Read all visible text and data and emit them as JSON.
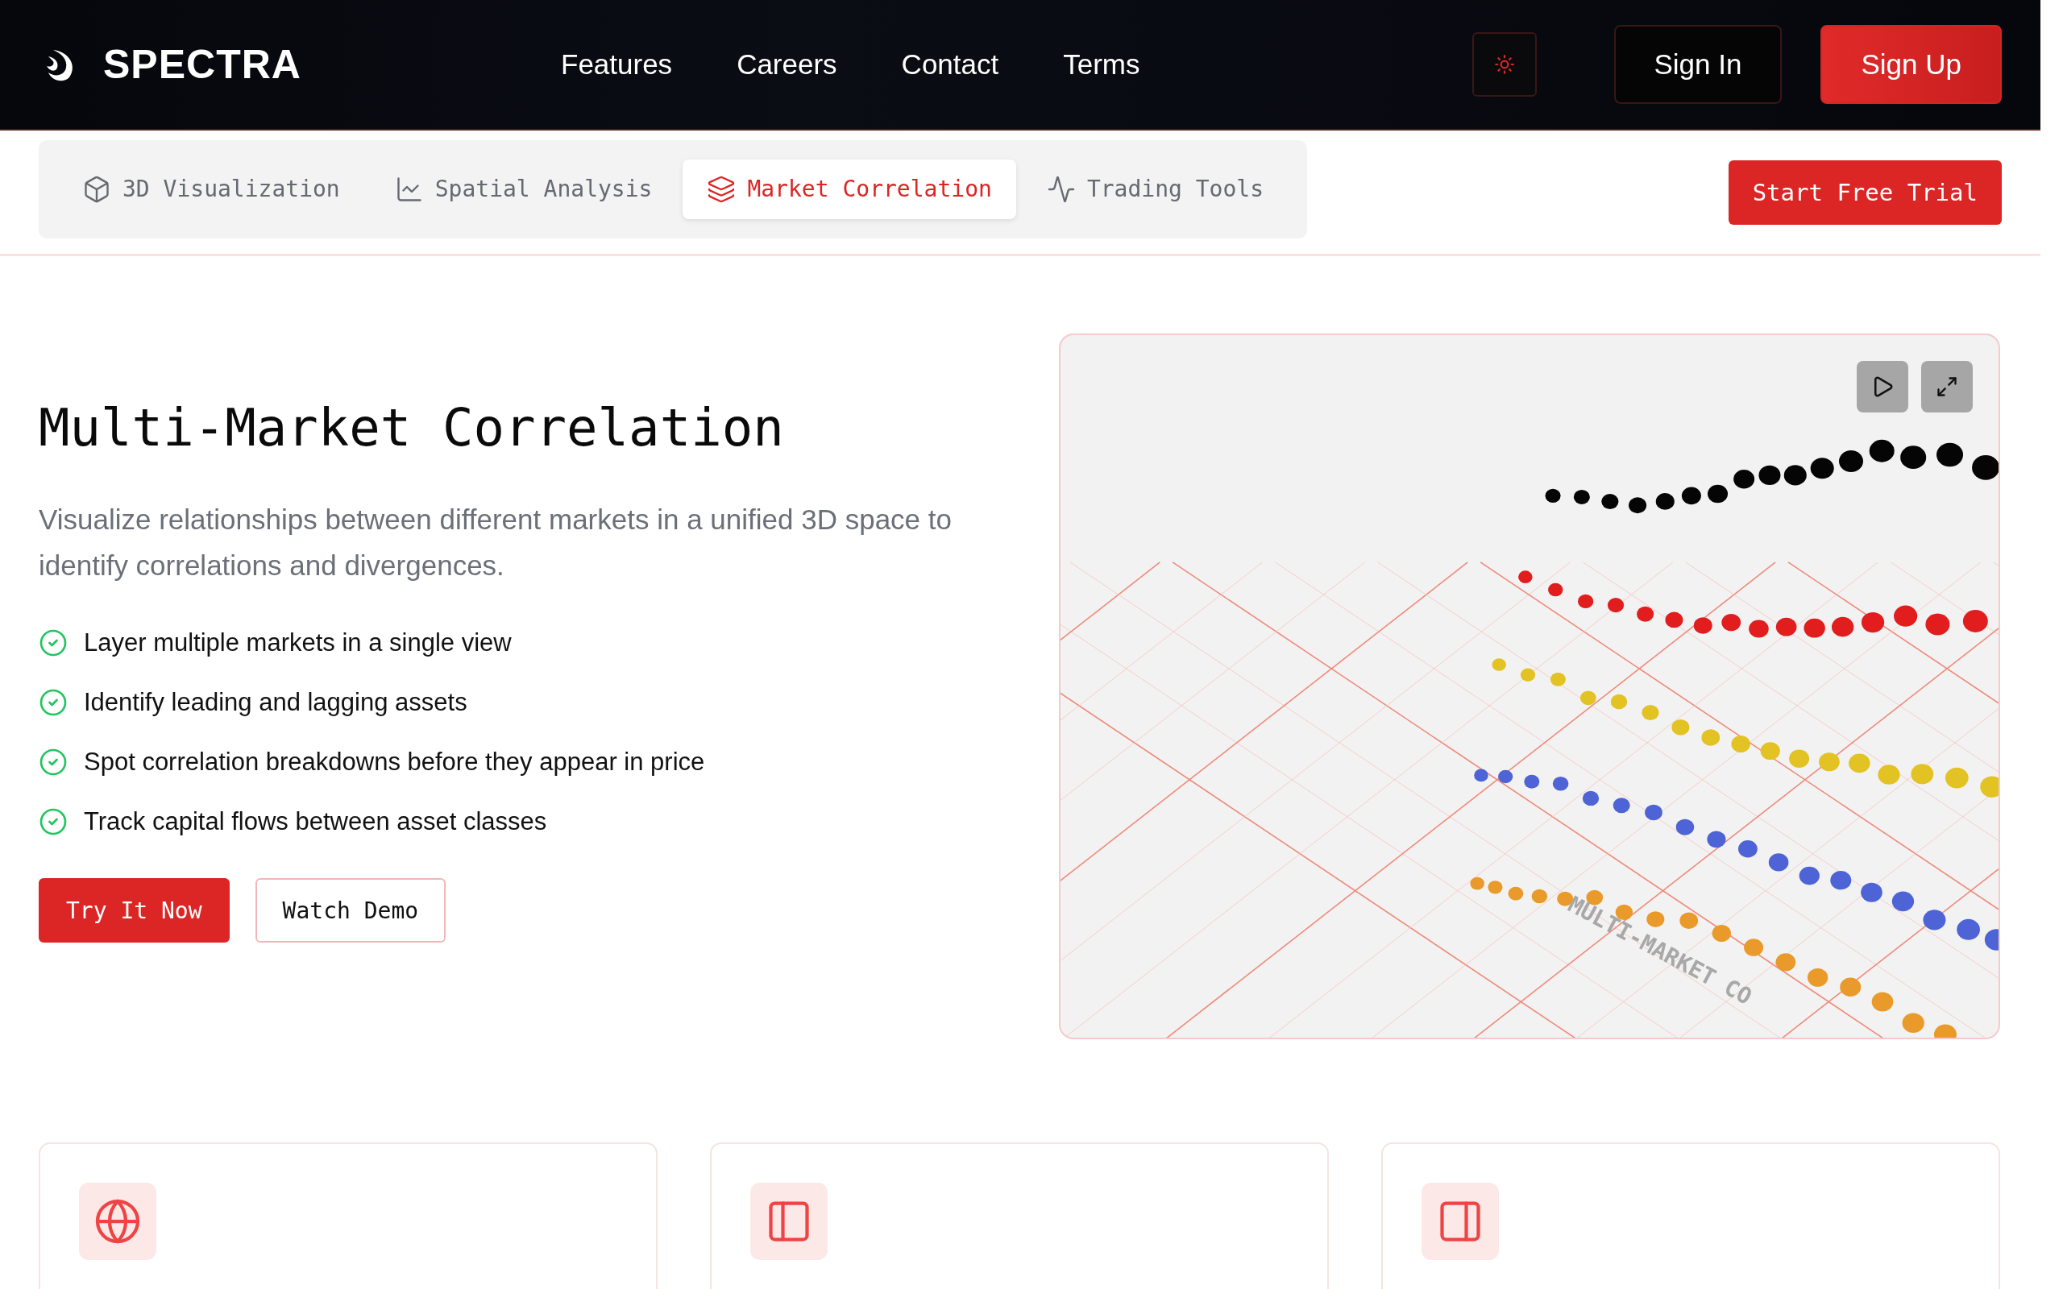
{
  "brand": {
    "name": "SPECTRA"
  },
  "nav": {
    "links": [
      "Features",
      "Careers",
      "Contact",
      "Terms"
    ]
  },
  "auth_buttons": [
    {
      "label": "Sign In",
      "kind": "outline"
    },
    {
      "label": "Sign Up",
      "kind": "primary"
    }
  ],
  "tabs": [
    {
      "label": "3D Visualization",
      "selected": false
    },
    {
      "label": "Spatial Analysis",
      "selected": false
    },
    {
      "label": "Market Correlation",
      "selected": true
    },
    {
      "label": "Trading Tools",
      "selected": false
    }
  ],
  "trial_button": "Start Free Trial",
  "hero": {
    "title": "Multi-Market Correlation",
    "description": "Visualize relationships between different markets in a unified 3D space to identify correlations and divergences.",
    "features": [
      "Layer multiple markets in a single view",
      "Identify leading and lagging assets",
      "Spot correlation breakdowns before they appear in price",
      "Track capital flows between asset classes"
    ],
    "buttons": [
      {
        "label": "Try It Now",
        "kind": "primary"
      },
      {
        "label": "Watch Demo",
        "kind": "outline"
      }
    ]
  },
  "viewer": {
    "scene_label": "MULTI-MARKET CO"
  }
}
